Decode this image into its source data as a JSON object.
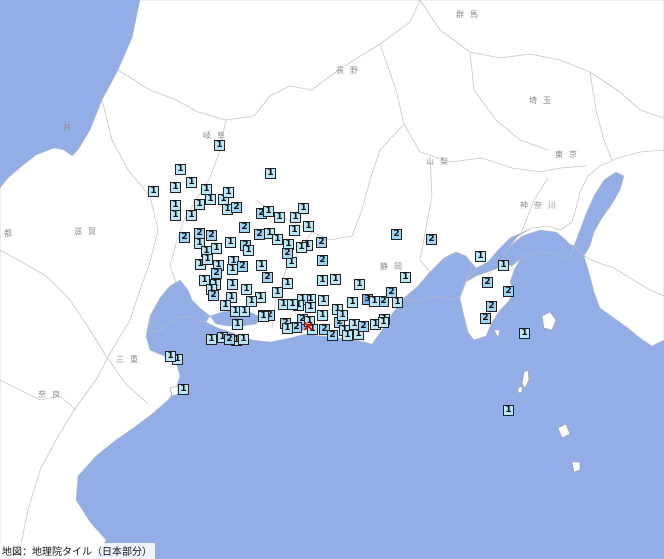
{
  "attribution": "地図：地理院タイル（日本部分）",
  "colors": {
    "sea": "#93aee6",
    "land": "#ffffff",
    "boundary": "#c8c8c8",
    "marker_int1": "#b9e7f7",
    "marker_int2": "#9fd4f6",
    "marker_int3": "#7fb0ee",
    "epicenter": "#e60000"
  },
  "icons": {
    "epicenter": "epicenter-cross-icon"
  },
  "epicenter_symbol": "×",
  "prefectures": [
    {
      "id": "gunma",
      "name": "群馬"
    },
    {
      "id": "nagano",
      "name": "長野"
    },
    {
      "id": "saitama",
      "name": "埼玉"
    },
    {
      "id": "gifu",
      "name": "岐阜"
    },
    {
      "id": "yamanashi",
      "name": "山梨"
    },
    {
      "id": "tokyo",
      "name": "東京"
    },
    {
      "id": "fukui",
      "name": "井"
    },
    {
      "id": "kanagawa",
      "name": "神奈川"
    },
    {
      "id": "shiga",
      "name": "滋賀"
    },
    {
      "id": "shizuoka",
      "name": "静岡"
    },
    {
      "id": "kyoto",
      "name": "都"
    },
    {
      "id": "mie",
      "name": "三重"
    },
    {
      "id": "nara",
      "name": "奈良"
    }
  ],
  "stations": [
    "1",
    "1",
    "1",
    "1",
    "1",
    "1",
    "1",
    "1",
    "1",
    "1",
    "1",
    "1",
    "2",
    "2",
    "1",
    "1",
    "1",
    "2",
    "2",
    "2",
    "2",
    "1",
    "2",
    "1",
    "1",
    "1",
    "1",
    "1",
    "1",
    "1",
    "2",
    "1",
    "1",
    "1",
    "2",
    "1",
    "1",
    "1",
    "1",
    "1",
    "1",
    "1",
    "1",
    "1",
    "1",
    "1",
    "1",
    "1",
    "2",
    "2",
    "1",
    "1",
    "1",
    "1",
    "2",
    "1",
    "1",
    "2",
    "1",
    "2",
    "1",
    "1",
    "1",
    "1",
    "1",
    "1",
    "1",
    "1",
    "1",
    "3",
    "2",
    "1",
    "1",
    "1",
    "1",
    "1",
    "2",
    "1",
    "1",
    "1",
    "1",
    "1",
    "1",
    "2",
    "1",
    "2",
    "1",
    "2",
    "2",
    "1",
    "1",
    "1",
    "2",
    "2",
    "1",
    "1",
    "1",
    "2",
    "1",
    "1",
    "2",
    "1",
    "2",
    "1",
    "1",
    "1",
    "2",
    "2",
    "2",
    "1",
    "2",
    "1",
    "2",
    "2",
    "2",
    "1",
    "1",
    "1",
    "1",
    "1",
    "1",
    "1",
    "1",
    "1",
    "1"
  ]
}
